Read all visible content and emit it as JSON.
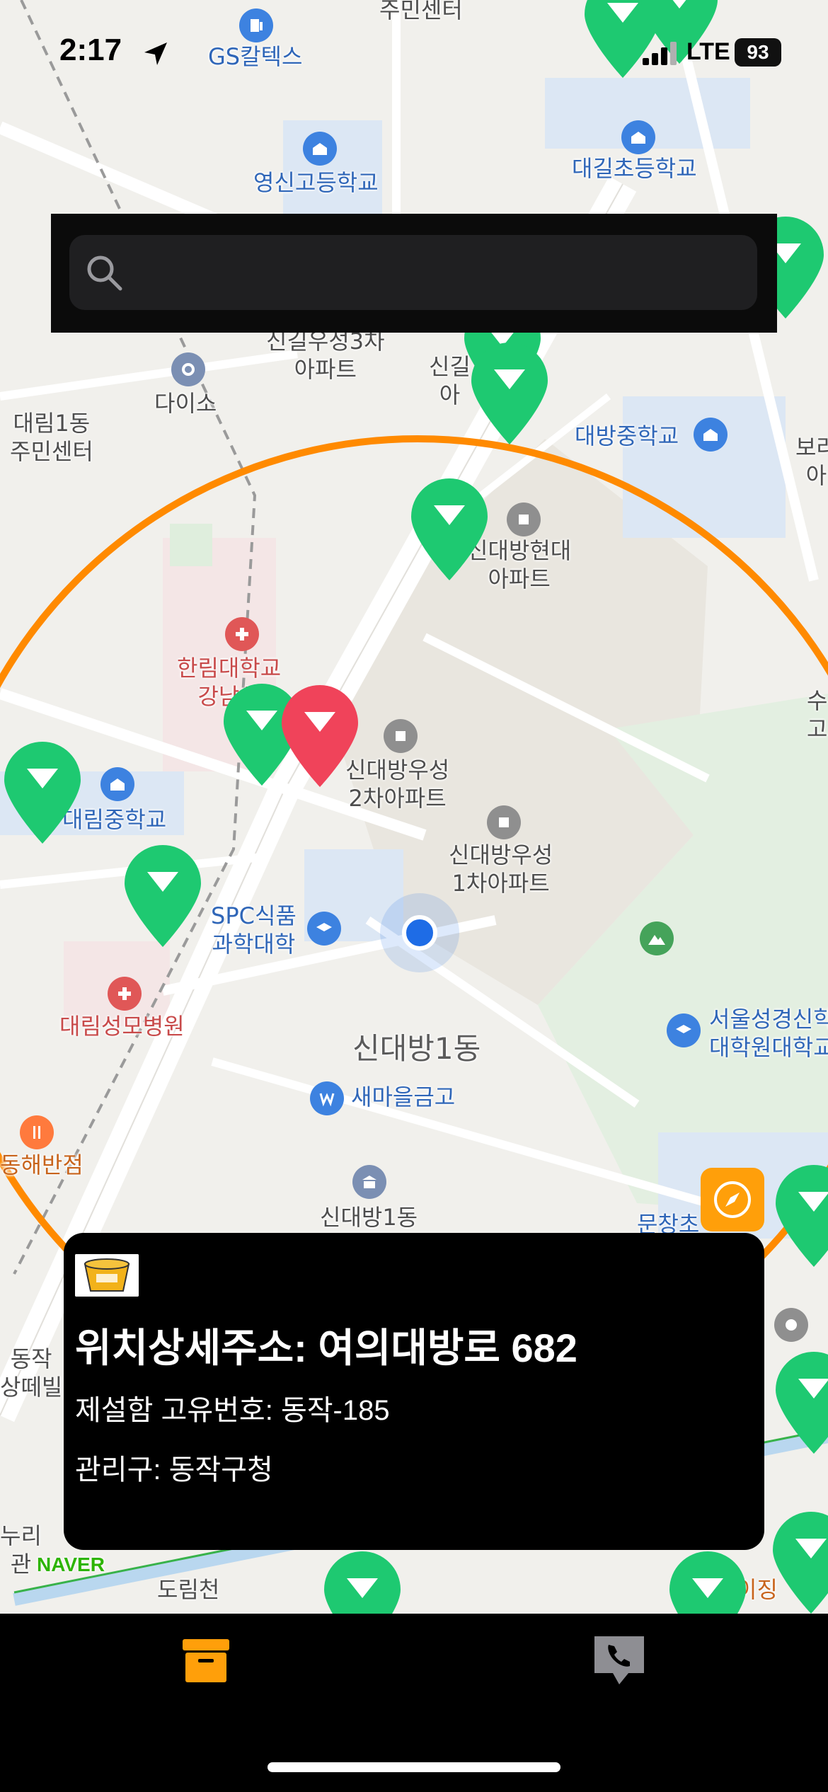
{
  "status_bar": {
    "time": "2:17",
    "network": "LTE",
    "battery": "93"
  },
  "search": {
    "placeholder": ""
  },
  "map": {
    "attribution": "NAVER",
    "labels": {
      "gs": "GS칼텍스",
      "community_top": "주민센터",
      "youngshin_high": "영신고등학교",
      "daegil_elem": "대길초등학교",
      "singil_woosung": "신길우성3차\n아파트",
      "singil_apt2": "신길\n아",
      "daiso": "다이소",
      "daerim1_center": "대림1동\n주민센터",
      "daebang_mid": "대방중학교",
      "bora": "보라\n아",
      "sindaebang_hyundai": "신대방현대\n아파트",
      "hallym": "한림대학교\n강남성",
      "sindaebang_woosung2": "신대방우성\n2차아파트",
      "daerim_mid": "대림중학교",
      "sindaebang_woosung1": "신대방우성\n1차아파트",
      "spc": "SPC식품\n과학대학",
      "seoul_bible": "서울성경신학\n대학원대학교",
      "daerim_hospital": "대림성모병원",
      "sindaebang1_dong": "신대방1동",
      "saemaeul": "새마을금고",
      "donghae": "동해반점",
      "sindaebang1_office": "신대방1동",
      "munchang": "문창초",
      "dongjak": "동작\n상떼빌",
      "nuri": "누리\n관",
      "dorimcheon": "도림천",
      "ijing": "이징",
      "su": "수\n고"
    },
    "colors": {
      "marker_green": "#1ec971",
      "marker_selected": "#f0435a",
      "range_circle": "#ff8a00",
      "user_location": "#1e6ce6"
    }
  },
  "info_card": {
    "address": "위치상세주소: 여의대방로 682",
    "unique_id": "제설함 고유번호: 동작-185",
    "district": "관리구: 동작구청"
  },
  "tabs": [
    {
      "icon": "archive-box-icon",
      "color": "#ff9f0a"
    },
    {
      "icon": "phone-bubble-icon",
      "color": "#8e8e93"
    }
  ]
}
